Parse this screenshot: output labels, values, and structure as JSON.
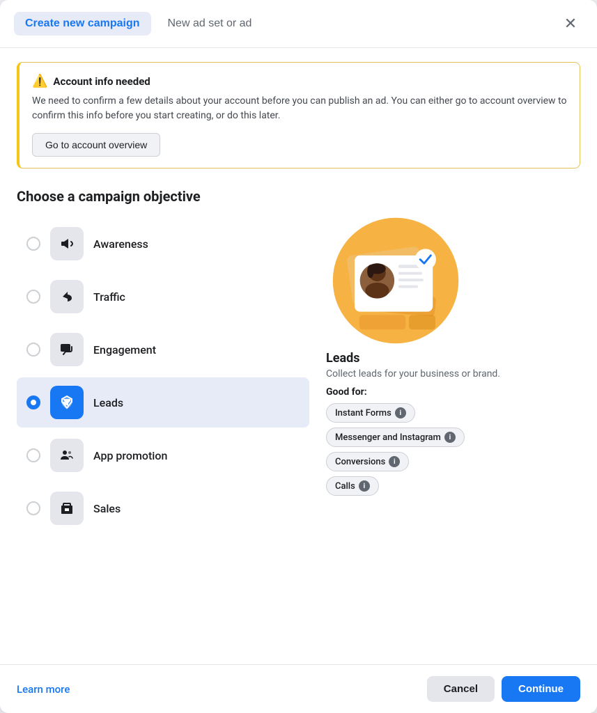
{
  "header": {
    "tab_active": "Create new campaign",
    "tab_inactive": "New ad set or ad",
    "close_label": "×"
  },
  "warning": {
    "title": "Account info needed",
    "warning_icon": "⚠",
    "text": "We need to confirm a few details about your account before you can publish an ad. You can either go to account overview to confirm this info before you start creating, or do this later.",
    "button_label": "Go to account overview"
  },
  "objective_section": {
    "title": "Choose a campaign objective",
    "objectives": [
      {
        "id": "awareness",
        "label": "Awareness",
        "icon": "📣",
        "selected": false
      },
      {
        "id": "traffic",
        "label": "Traffic",
        "icon": "▶",
        "selected": false
      },
      {
        "id": "engagement",
        "label": "Engagement",
        "icon": "💬",
        "selected": false
      },
      {
        "id": "leads",
        "label": "Leads",
        "icon": "🔽",
        "selected": true
      },
      {
        "id": "app-promotion",
        "label": "App promotion",
        "icon": "👥",
        "selected": false
      },
      {
        "id": "sales",
        "label": "Sales",
        "icon": "🛍",
        "selected": false
      }
    ]
  },
  "detail": {
    "title": "Leads",
    "description": "Collect leads for your business or brand.",
    "good_for_label": "Good for:",
    "tags": [
      {
        "label": "Instant Forms",
        "info": "i"
      },
      {
        "label": "Messenger and Instagram",
        "info": "i"
      },
      {
        "label": "Conversions",
        "info": "i"
      },
      {
        "label": "Calls",
        "info": "i"
      }
    ]
  },
  "footer": {
    "learn_more": "Learn more",
    "cancel": "Cancel",
    "continue": "Continue"
  },
  "colors": {
    "accent": "#1877f2",
    "warning_border": "#f5c518",
    "selected_bg": "#e7eaf7"
  }
}
